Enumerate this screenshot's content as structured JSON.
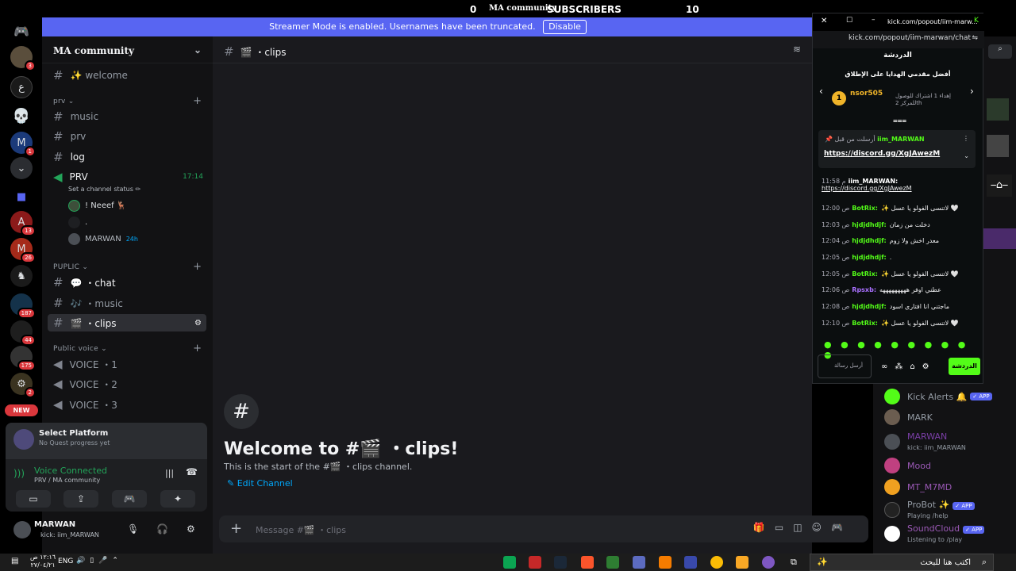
{
  "topbar": {
    "count_left": "0",
    "community": "MA community",
    "subscribers": "SUBSCRIBERS",
    "count_right": "10"
  },
  "banner": {
    "text": "Streamer Mode is enabled. Usernames have been truncated.",
    "button": "Disable"
  },
  "guild_badges": [
    "3",
    "1",
    "13",
    "26",
    "187",
    "44",
    "175",
    "2"
  ],
  "guild_new": "NEW",
  "server": {
    "name": "MA community"
  },
  "channels": {
    "welcome": "✨ welcome",
    "cat_prv": "prv",
    "music": "music",
    "prv": "prv",
    "log": "log",
    "voice_prv": "PRV",
    "voice_prv_time": "17:14",
    "set_status": "Set a channel status ✏",
    "voice_users": [
      "! Neeef 🦌",
      ".",
      "MARWAN"
    ],
    "voice_user_badge": "24h",
    "cat_puplic": "PUPLIC",
    "chat": "💬 ・chat",
    "music2": "🎶 ・music",
    "clips": "🎬 ・clips",
    "cat_public_voice": "Public voice",
    "voice1": "VOICE ・1",
    "voice2": "VOICE ・2",
    "voice3": "VOICE ・3"
  },
  "quest": {
    "title": "Select Platform",
    "sub": "No Quest progress yet"
  },
  "voice_connected": {
    "title": "Voice Connected",
    "sub": "PRV / MA community"
  },
  "user": {
    "name": "MARWAN",
    "status": "kick: iim_MARWAN"
  },
  "main": {
    "channel": "🎬 ・clips",
    "welcome_title": "Welcome to #🎬 ・clips!",
    "welcome_sub": "This is the start of the #🎬 ・clips channel.",
    "edit": "Edit Channel",
    "composer_placeholder": "Message #🎬 ・clips"
  },
  "popup": {
    "url_title": "kick.com/popout/iim-marw...",
    "url": "kick.com/popout/iim-marwan/chat",
    "chat_title": "الدردشة",
    "top_gifters": "أفضل مقدمي الهدايا على الإطلاق",
    "gifter_name": "nsor505",
    "gifter_count": "1",
    "gifter_rank": "إهداء 1 اشتراك للوصول للمركز 2th",
    "pinned_by": "أرسلت من قبل",
    "pinned_user": "iim_MARWAN",
    "pinned_link": "https://discord.gg/XgJAwezM",
    "messages": [
      {
        "time": "11:58 م",
        "user": "iim_MARWAN:",
        "text": "https://discord.gg/XgJAwezM",
        "color": "#ffffff"
      },
      {
        "time": "12:00 ص",
        "user": "BotRix:",
        "text": "✨ لاتنسى الفولو يا عسل 🤍",
        "color": "#53fc18"
      },
      {
        "time": "12:03 ص",
        "user": "hjdjdhdjf:",
        "text": "دخلت من زمان",
        "color": "#53fc18"
      },
      {
        "time": "12:04 ص",
        "user": "hjdjdhdjf:",
        "text": "معدر اخش ولا زوم",
        "color": "#53fc18"
      },
      {
        "time": "12:05 ص",
        "user": "hjdjdhdjf:",
        "text": ".",
        "color": "#53fc18"
      },
      {
        "time": "12:05 ص",
        "user": "BotRix:",
        "text": "✨ لاتنسى الفولو يا عسل 🤍",
        "color": "#53fc18"
      },
      {
        "time": "12:06 ص",
        "user": "Rpsxb:",
        "text": "عطني اوفر هههههههههه",
        "color": "#a970ff"
      },
      {
        "time": "12:08 ص",
        "user": "hjdjdhdjf:",
        "text": "ماجتني انا افتاري اسود",
        "color": "#53fc18"
      },
      {
        "time": "12:10 ص",
        "user": "BotRix:",
        "text": "✨ لاتنسى الفولو يا عسل 🤍",
        "color": "#53fc18"
      }
    ],
    "input_placeholder": "أرسل رسالة",
    "send": "الدردشة"
  },
  "members": [
    {
      "name": "Kick Alerts 🔔",
      "app": "✓ APP",
      "sub": "",
      "color": "#949ba4",
      "avatar": "#53fc18"
    },
    {
      "name": "MARK",
      "app": "",
      "sub": ".",
      "color": "#949ba4",
      "avatar": "#6b5d50"
    },
    {
      "name": "MARWAN",
      "app": "",
      "sub": "kick: iim_MARWAN",
      "color": "#7b3fa8",
      "avatar": "#4b4f55"
    },
    {
      "name": "Mood",
      "app": "",
      "sub": "",
      "color": "#9b59b6",
      "avatar": "#c04080"
    },
    {
      "name": "MT_M7MD",
      "app": "",
      "sub": "",
      "color": "#9b59b6",
      "avatar": "#f0a020"
    },
    {
      "name": "ProBot ✨",
      "app": "✓ APP",
      "sub": "Playing /help",
      "color": "#949ba4",
      "avatar": "#222"
    },
    {
      "name": "SoundCloud",
      "app": "✓ APP",
      "sub": "Listening to /play",
      "color": "#9b59b6",
      "avatar": "#fff"
    }
  ],
  "taskbar": {
    "time": "١٢:١٦ ص",
    "date": "٢٧/٠٤/٢١",
    "lang": "ENG",
    "search": "اكتب هنا للبحث"
  }
}
